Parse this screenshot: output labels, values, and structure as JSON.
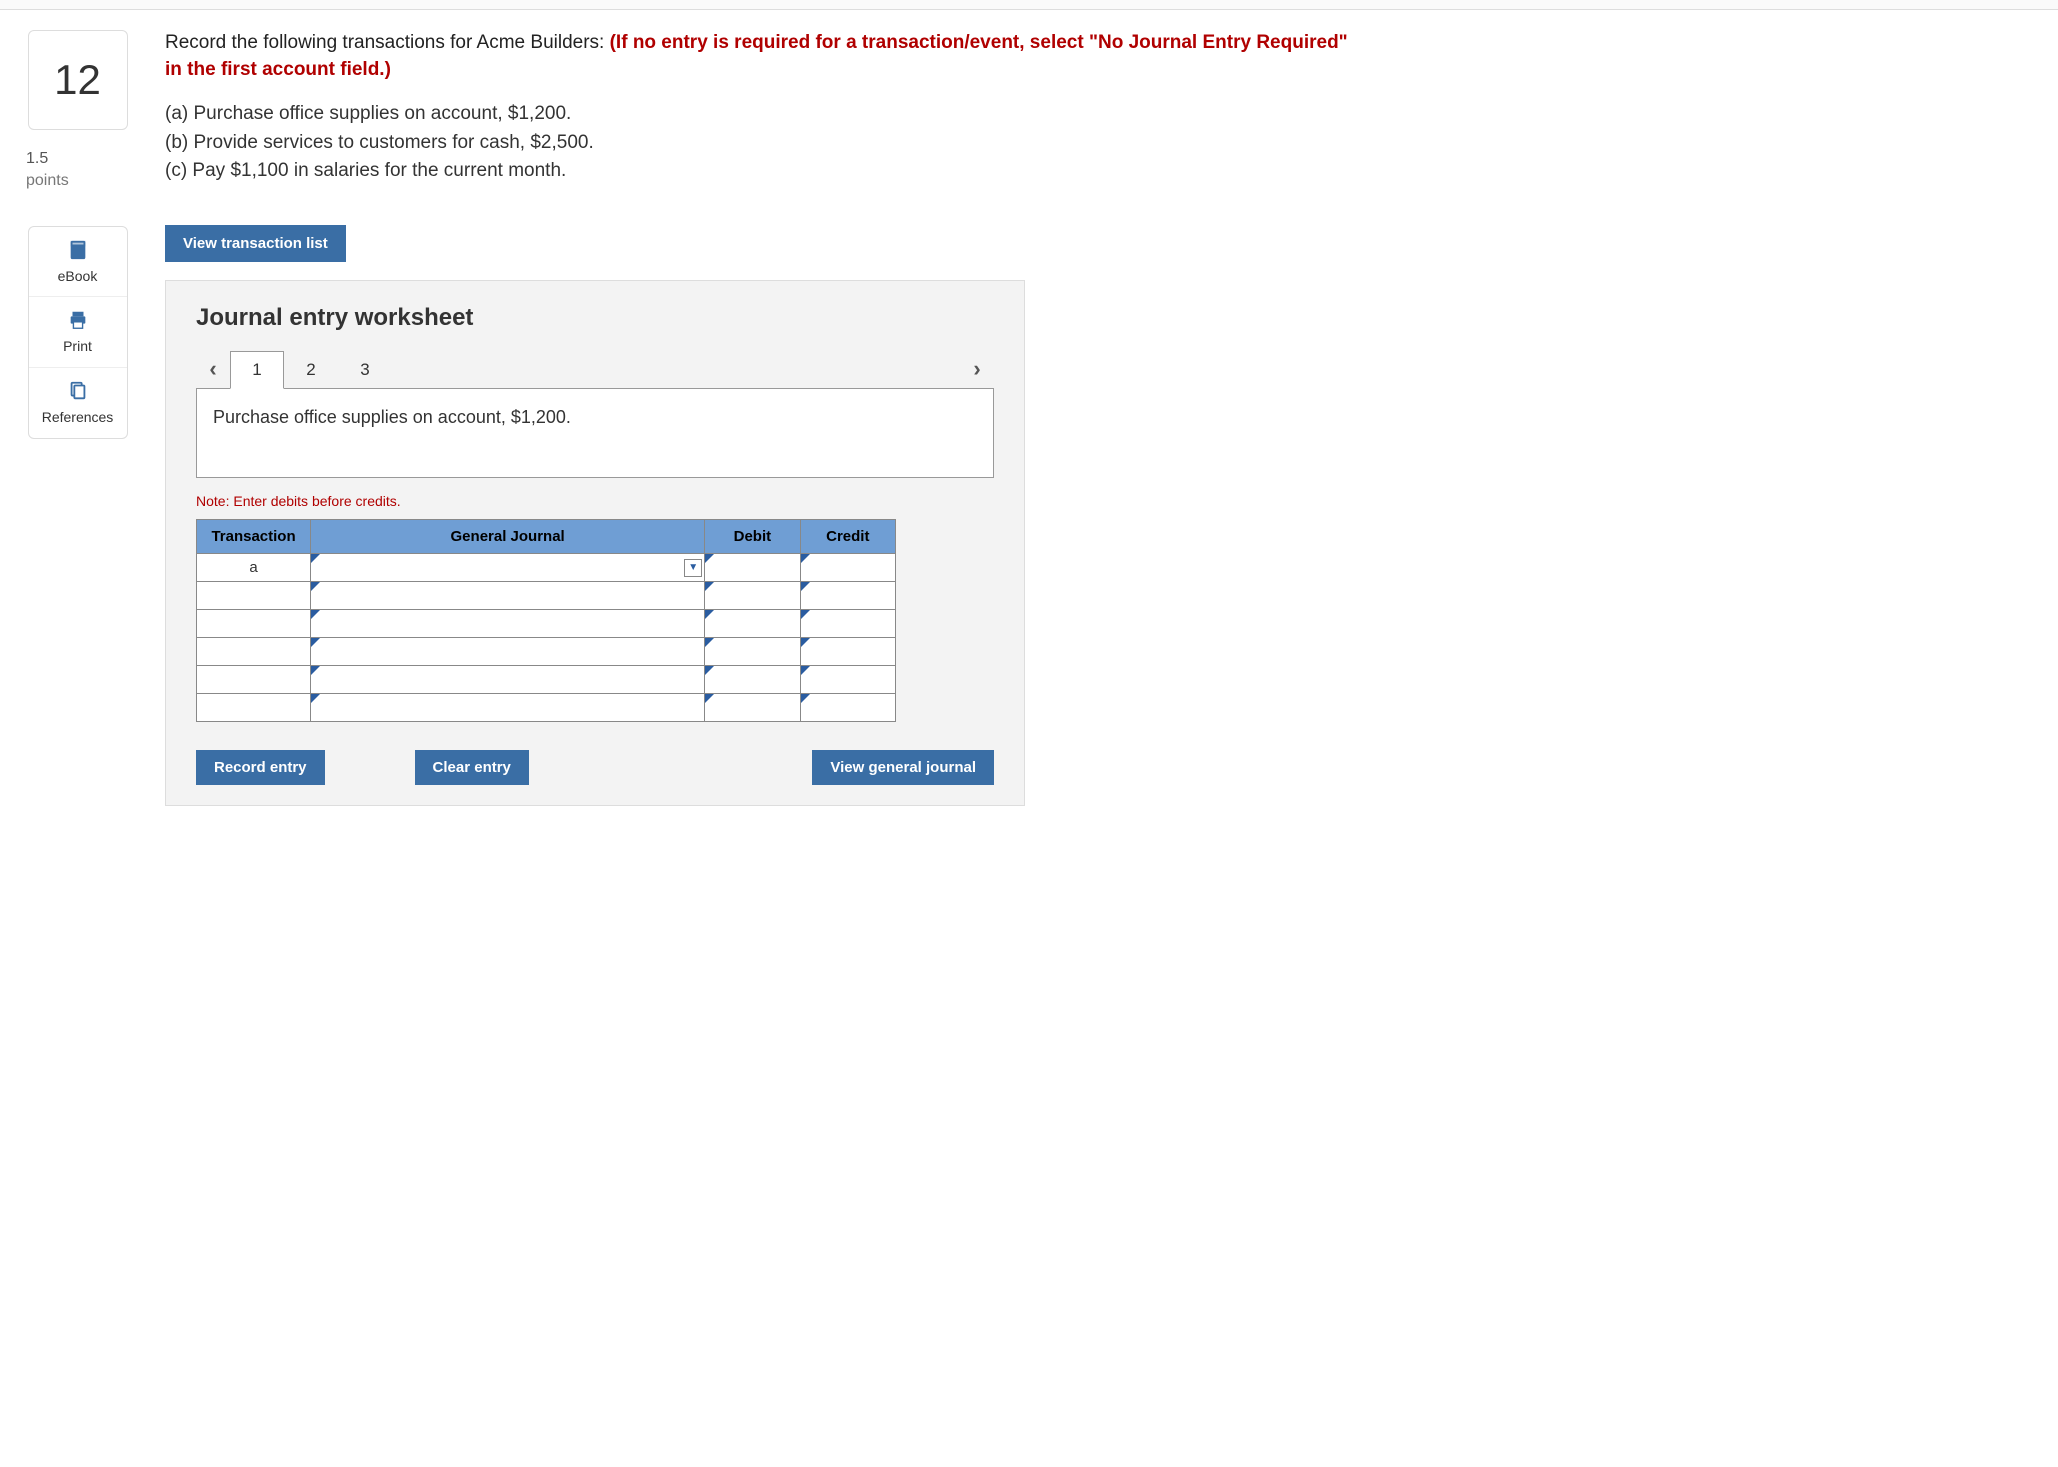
{
  "question": {
    "number": "12",
    "points_value": "1.5",
    "points_label": "points"
  },
  "sidebar": {
    "ebook_label": "eBook",
    "print_label": "Print",
    "references_label": "References"
  },
  "prompt": {
    "intro": "Record the following transactions for Acme Builders: ",
    "red_note": "(If no entry is required for a transaction/event, select \"No Journal Entry Required\" in the first account field.)"
  },
  "transactions": {
    "a": "(a) Purchase office supplies on account, $1,200.",
    "b": "(b) Provide services to customers for cash, $2,500.",
    "c": "(c) Pay $1,100 in salaries for the current month."
  },
  "buttons": {
    "view_tx_list": "View transaction list",
    "record_entry": "Record entry",
    "clear_entry": "Clear entry",
    "view_general_journal": "View general journal"
  },
  "worksheet": {
    "title": "Journal entry worksheet",
    "tabs": [
      "1",
      "2",
      "3"
    ],
    "active_tab_index": 0,
    "description": "Purchase office supplies on account, $1,200.",
    "note": "Note: Enter debits before credits.",
    "headers": {
      "transaction": "Transaction",
      "general_journal": "General Journal",
      "debit": "Debit",
      "credit": "Credit"
    },
    "rows": [
      {
        "transaction": "a",
        "account": "",
        "debit": "",
        "credit": "",
        "dropdown": true
      },
      {
        "transaction": "",
        "account": "",
        "debit": "",
        "credit": "",
        "dropdown": false
      },
      {
        "transaction": "",
        "account": "",
        "debit": "",
        "credit": "",
        "dropdown": false
      },
      {
        "transaction": "",
        "account": "",
        "debit": "",
        "credit": "",
        "dropdown": false
      },
      {
        "transaction": "",
        "account": "",
        "debit": "",
        "credit": "",
        "dropdown": false
      },
      {
        "transaction": "",
        "account": "",
        "debit": "",
        "credit": "",
        "dropdown": false
      }
    ]
  }
}
